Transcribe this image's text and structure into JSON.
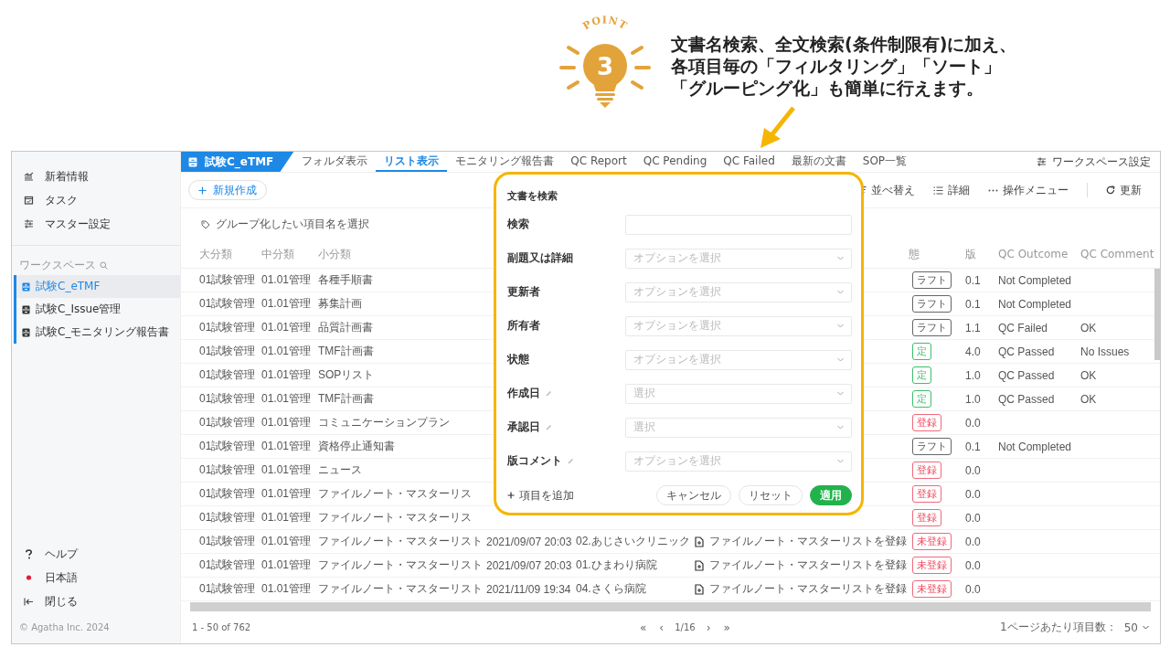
{
  "callout": {
    "badge": "POINT",
    "number": "3",
    "lines": [
      "文書名検索、全文検索(条件制限有)に加え、",
      "各項目毎の「フィルタリング」「ソート」",
      "「グルーピング化」も簡単に行えます。"
    ]
  },
  "sidebar": {
    "nav": [
      {
        "kind": "news",
        "label": "新着情報"
      },
      {
        "kind": "task",
        "label": "タスク"
      },
      {
        "kind": "master",
        "label": "マスター設定"
      }
    ],
    "workspace_heading": "ワークスペース",
    "workspaces": [
      {
        "label": "試験C_eTMF",
        "selected": true
      },
      {
        "label": "試験C_Issue管理",
        "selected": false
      },
      {
        "label": "試験C_モニタリング報告書",
        "selected": false
      }
    ],
    "bottom": [
      {
        "kind": "help",
        "label": "ヘルプ"
      },
      {
        "kind": "language",
        "label": "日本語"
      },
      {
        "kind": "close",
        "label": "閉じる"
      }
    ],
    "copyright": "© Agatha Inc. 2024"
  },
  "workspace_tab": {
    "label": "試験C_eTMF"
  },
  "tabs": [
    {
      "label": "フォルダ表示",
      "selected": false
    },
    {
      "label": "リスト表示",
      "selected": true
    },
    {
      "label": "モニタリング報告書",
      "selected": false
    },
    {
      "label": "QC Report",
      "selected": false
    },
    {
      "label": "QC Pending",
      "selected": false
    },
    {
      "label": "QC Failed",
      "selected": false
    },
    {
      "label": "最新の文書",
      "selected": false
    },
    {
      "label": "SOP一覧",
      "selected": false
    }
  ],
  "workspace_settings": "ワークスペース設定",
  "toolbar": {
    "new": "新規作成",
    "sort": "並べ替え",
    "details": "詳細",
    "menu": "操作メニュー",
    "refresh": "更新"
  },
  "group_hint": "グループ化したい項目名を選択",
  "table": {
    "columns": [
      "大分類",
      "中分類",
      "小分類",
      "態",
      "版",
      "QC Outcome",
      "QC Comment"
    ],
    "rows": [
      {
        "major": "01試験管理",
        "middle": "01.01管理",
        "minor": "各種手順書",
        "status": {
          "text": "ラフト",
          "kind": "draft"
        },
        "version": "0.1",
        "qc_outcome": "Not Completed"
      },
      {
        "major": "01試験管理",
        "middle": "01.01管理",
        "minor": "募集計画",
        "status": {
          "text": "ラフト",
          "kind": "draft"
        },
        "version": "0.1",
        "qc_outcome": "Not Completed"
      },
      {
        "major": "01試験管理",
        "middle": "01.01管理",
        "minor": "品質計画書",
        "status": {
          "text": "ラフト",
          "kind": "draft"
        },
        "version": "1.1",
        "qc_outcome": "QC Failed",
        "qc_comment": "OK"
      },
      {
        "major": "01試験管理",
        "middle": "01.01管理",
        "minor": "TMF計画書",
        "status": {
          "text": "定",
          "kind": "final"
        },
        "version": "4.0",
        "qc_outcome": "QC Passed",
        "qc_comment": "No Issues"
      },
      {
        "major": "01試験管理",
        "middle": "01.01管理",
        "minor": "SOPリスト",
        "status": {
          "text": "定",
          "kind": "final"
        },
        "version": "1.0",
        "qc_outcome": "QC Passed",
        "qc_comment": "OK"
      },
      {
        "major": "01試験管理",
        "middle": "01.01管理",
        "minor": "TMF計画書",
        "status": {
          "text": "定",
          "kind": "final"
        },
        "version": "1.0",
        "qc_outcome": "QC Passed",
        "qc_comment": "OK"
      },
      {
        "major": "01試験管理",
        "middle": "01.01管理",
        "minor": "コミュニケーションプラン",
        "status": {
          "text": "登録",
          "kind": "unregistered"
        },
        "version": "0.0"
      },
      {
        "major": "01試験管理",
        "middle": "01.01管理",
        "minor": "資格停止通知書",
        "status": {
          "text": "ラフト",
          "kind": "draft"
        },
        "version": "0.1",
        "qc_outcome": "Not Completed"
      },
      {
        "major": "01試験管理",
        "middle": "01.01管理",
        "minor": "ニュース",
        "status": {
          "text": "登録",
          "kind": "unregistered"
        },
        "version": "0.0"
      },
      {
        "major": "01試験管理",
        "middle": "01.01管理",
        "minor": "ファイルノート・マスターリス",
        "status": {
          "text": "登録",
          "kind": "unregistered"
        },
        "version": "0.0"
      },
      {
        "major": "01試験管理",
        "middle": "01.01管理",
        "minor": "ファイルノート・マスターリス",
        "status": {
          "text": "登録",
          "kind": "unregistered"
        },
        "version": "0.0"
      },
      {
        "major": "01試験管理",
        "middle": "01.01管理",
        "minor": "ファイルノート・マスターリスト",
        "date": "2021/09/07 20:03",
        "site": "02.あじさいクリニック",
        "document": true,
        "title": "ファイルノート・マスターリストを登録",
        "status": {
          "text": "未登録",
          "kind": "unregistered"
        },
        "version": "0.0"
      },
      {
        "major": "01試験管理",
        "middle": "01.01管理",
        "minor": "ファイルノート・マスターリスト",
        "date": "2021/09/07 20:03",
        "site": "01.ひまわり病院",
        "document": true,
        "title": "ファイルノート・マスターリストを登録",
        "status": {
          "text": "未登録",
          "kind": "unregistered"
        },
        "version": "0.0"
      },
      {
        "major": "01試験管理",
        "middle": "01.01管理",
        "minor": "ファイルノート・マスターリスト",
        "date": "2021/11/09 19:34",
        "site": "04.さくら病院",
        "document": true,
        "title": "ファイルノート・マスターリストを登録",
        "status": {
          "text": "未登録",
          "kind": "unregistered"
        },
        "version": "0.0"
      }
    ]
  },
  "footer": {
    "range": "1 - 50 of 762",
    "pager": {
      "first": "«",
      "prev": "‹",
      "page": "1/16",
      "next": "›",
      "last": "»"
    },
    "per_page_label": "1ページあたり項目数：",
    "per_page": "50"
  },
  "search_dialog": {
    "title": "文書を検索",
    "fields": [
      {
        "label": "検索",
        "kind": "text",
        "custom": false
      },
      {
        "label": "副題又は詳細",
        "kind": "select",
        "placeholder": "オプションを選択",
        "custom": false
      },
      {
        "label": "更新者",
        "kind": "select",
        "placeholder": "オプションを選択",
        "custom": false
      },
      {
        "label": "所有者",
        "kind": "select",
        "placeholder": "オプションを選択",
        "custom": false
      },
      {
        "label": "状態",
        "kind": "select",
        "placeholder": "オプションを選択",
        "custom": false
      },
      {
        "label": "作成日",
        "kind": "select",
        "placeholder": "選択",
        "custom": true
      },
      {
        "label": "承認日",
        "kind": "select",
        "placeholder": "選択",
        "custom": true
      },
      {
        "label": "版コメント",
        "kind": "select",
        "placeholder": "オプションを選択",
        "custom": true
      }
    ],
    "add_field": "項目を追加",
    "cancel": "キャンセル",
    "reset": "リセット",
    "apply": "適用"
  }
}
